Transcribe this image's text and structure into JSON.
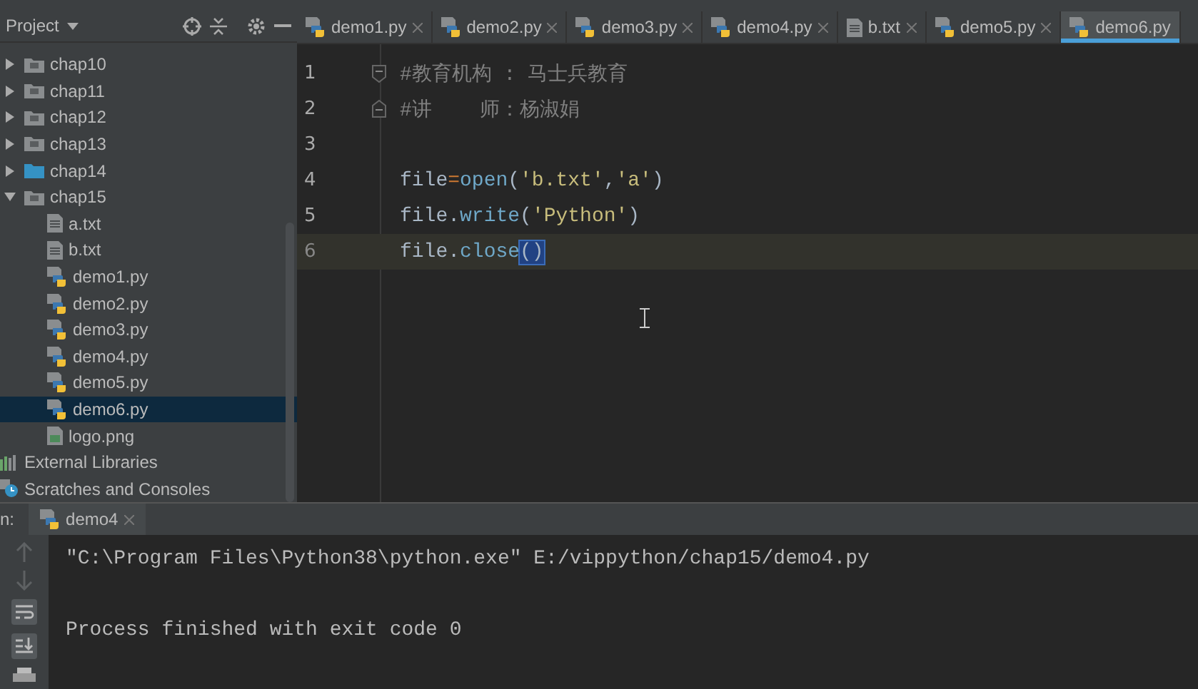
{
  "project_panel": {
    "title": "Project",
    "tree": [
      {
        "label": "chap10",
        "kind": "folder",
        "expanded": false,
        "selected": false
      },
      {
        "label": "chap11",
        "kind": "folder",
        "expanded": false,
        "selected": false
      },
      {
        "label": "chap12",
        "kind": "folder",
        "expanded": false,
        "selected": false
      },
      {
        "label": "chap13",
        "kind": "folder",
        "expanded": false,
        "selected": false
      },
      {
        "label": "chap14",
        "kind": "marked_folder",
        "expanded": false,
        "selected": false
      },
      {
        "label": "chap15",
        "kind": "folder",
        "expanded": true,
        "selected": false,
        "children": [
          {
            "label": "a.txt",
            "kind": "text",
            "selected": false
          },
          {
            "label": "b.txt",
            "kind": "text",
            "selected": false
          },
          {
            "label": "demo1.py",
            "kind": "python",
            "selected": false
          },
          {
            "label": "demo2.py",
            "kind": "python",
            "selected": false
          },
          {
            "label": "demo3.py",
            "kind": "python",
            "selected": false
          },
          {
            "label": "demo4.py",
            "kind": "python",
            "selected": false
          },
          {
            "label": "demo5.py",
            "kind": "python",
            "selected": false
          },
          {
            "label": "demo6.py",
            "kind": "python",
            "selected": true
          },
          {
            "label": "logo.png",
            "kind": "image",
            "selected": false
          }
        ]
      },
      {
        "label": "External Libraries",
        "kind": "libraries",
        "selected": false
      },
      {
        "label": "Scratches and Consoles",
        "kind": "scratches",
        "selected": false
      }
    ]
  },
  "editor_tabs": [
    {
      "label": "demo1.py",
      "kind": "python",
      "selected": false
    },
    {
      "label": "demo2.py",
      "kind": "python",
      "selected": false
    },
    {
      "label": "demo3.py",
      "kind": "python",
      "selected": false
    },
    {
      "label": "demo4.py",
      "kind": "python",
      "selected": false
    },
    {
      "label": "b.txt",
      "kind": "text",
      "selected": false
    },
    {
      "label": "demo5.py",
      "kind": "python",
      "selected": false
    },
    {
      "label": "demo6.py",
      "kind": "python",
      "selected": true
    }
  ],
  "editor": {
    "lines": [
      {
        "number": "1",
        "current": false,
        "fold_start": true,
        "fold_end": false,
        "segments": [
          {
            "kind": "comment",
            "text": "#教育机构 : 马士兵教育"
          }
        ]
      },
      {
        "number": "2",
        "current": false,
        "fold_start": false,
        "fold_end": true,
        "segments": [
          {
            "kind": "comment",
            "text": "#讲    师：杨淑娟"
          }
        ]
      },
      {
        "number": "3",
        "current": false,
        "fold_start": false,
        "fold_end": false
      },
      {
        "number": "4",
        "current": false,
        "fold_start": false,
        "fold_end": false,
        "segments": [
          {
            "kind": "plain",
            "text": "file"
          },
          {
            "kind": "operator",
            "text": "="
          },
          {
            "kind": "call",
            "text": "open"
          },
          {
            "kind": "plain",
            "text": "("
          },
          {
            "kind": "string",
            "text": "'b.txt'"
          },
          {
            "kind": "plain",
            "text": ","
          },
          {
            "kind": "string",
            "text": "'a'"
          },
          {
            "kind": "plain",
            "text": ")"
          }
        ]
      },
      {
        "number": "5",
        "current": false,
        "fold_start": false,
        "fold_end": false,
        "segments": [
          {
            "kind": "plain",
            "text": "file."
          },
          {
            "kind": "call",
            "text": "write"
          },
          {
            "kind": "plain",
            "text": "("
          },
          {
            "kind": "string",
            "text": "'Python'"
          },
          {
            "kind": "plain",
            "text": ")"
          }
        ]
      },
      {
        "number": "6",
        "current": true,
        "fold_start": false,
        "fold_end": false,
        "segments": [
          {
            "kind": "plain",
            "text": "file."
          },
          {
            "kind": "call",
            "text": "close"
          },
          {
            "kind": "matched",
            "text": "()"
          }
        ]
      }
    ]
  },
  "run_panel": {
    "label": "n:",
    "tab": "demo4",
    "output": [
      "\"C:\\Program Files\\Python38\\python.exe\" E:/vippython/chap15/demo4.py",
      "Process finished with exit code 0"
    ]
  }
}
